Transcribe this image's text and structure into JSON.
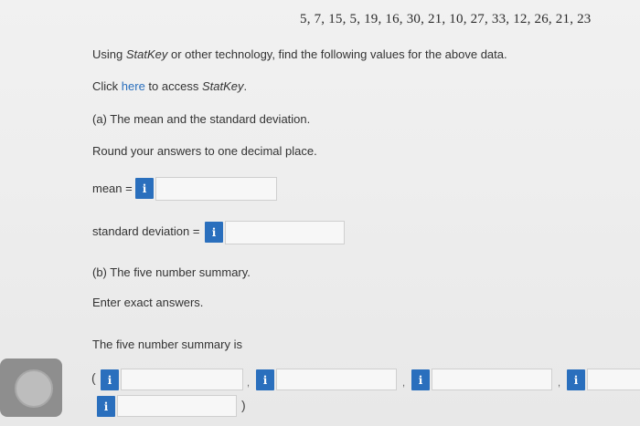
{
  "dataset": "5, 7, 15, 5, 19, 16, 30, 21, 10, 27, 33, 12, 26, 21, 23",
  "instructions": {
    "main_prefix": "Using ",
    "main_italic": "StatKey",
    "main_suffix": " or other technology, find the following values for the above data.",
    "click_prefix": "Click ",
    "click_link": "here",
    "click_middle": " to access ",
    "click_italic": "StatKey",
    "click_suffix": "."
  },
  "part_a": {
    "title": "(a) The mean and the standard deviation.",
    "round_note": "Round your answers to one decimal place.",
    "mean_label": "mean =",
    "sd_label": "standard deviation ="
  },
  "part_b": {
    "title": "(b) The five number summary.",
    "exact_note": "Enter exact answers.",
    "summary_label": "The five number summary is",
    "open_paren": "(",
    "close_paren": ")",
    "separator": ","
  },
  "info_glyph": "i",
  "colors": {
    "link": "#2a6fbd",
    "info_button": "#2a6fbd"
  }
}
